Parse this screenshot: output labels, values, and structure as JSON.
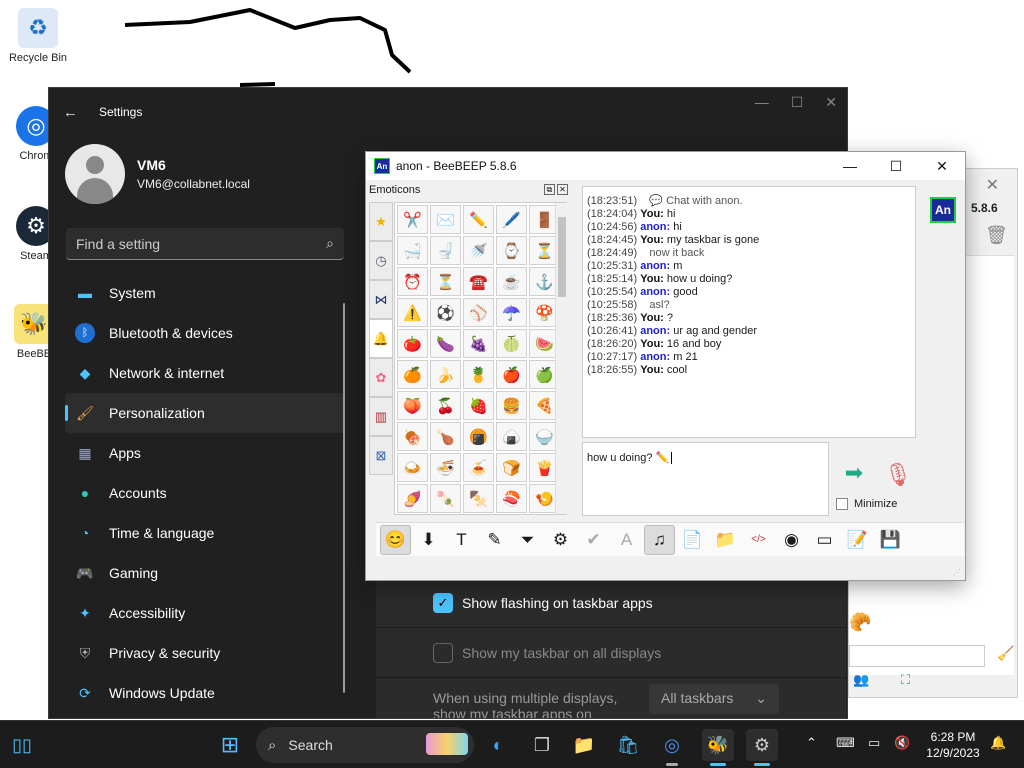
{
  "desktop": {
    "icons": [
      {
        "label": "Recycle Bin",
        "icon": "recycle-bin-icon"
      },
      {
        "label": "Chrom",
        "icon": "chrome-icon"
      },
      {
        "label": "Steam",
        "icon": "steam-icon"
      },
      {
        "label": "BeeBE",
        "icon": "beebeep-icon"
      }
    ]
  },
  "settings": {
    "title": "Settings",
    "user_name": "VM6",
    "user_email": "VM6@collabnet.local",
    "search_placeholder": "Find a setting",
    "nav": [
      {
        "label": "System",
        "icon": "monitor-icon"
      },
      {
        "label": "Bluetooth & devices",
        "icon": "bluetooth-icon"
      },
      {
        "label": "Network & internet",
        "icon": "wifi-icon"
      },
      {
        "label": "Personalization",
        "icon": "brush-icon",
        "active": true
      },
      {
        "label": "Apps",
        "icon": "apps-icon"
      },
      {
        "label": "Accounts",
        "icon": "person-icon"
      },
      {
        "label": "Time & language",
        "icon": "globe-clock-icon"
      },
      {
        "label": "Gaming",
        "icon": "gamepad-icon"
      },
      {
        "label": "Accessibility",
        "icon": "accessibility-icon"
      },
      {
        "label": "Privacy & security",
        "icon": "shield-icon"
      },
      {
        "label": "Windows Update",
        "icon": "update-icon"
      }
    ],
    "options": [
      {
        "label": "Show flashing on taskbar apps",
        "checked": true
      },
      {
        "label": "Show my taskbar on all displays",
        "checked": false
      }
    ],
    "multi_display_label": "When using multiple displays, show my taskbar apps on",
    "multi_display_value": "All taskbars"
  },
  "beebeep_back": {
    "version": "5.8.6"
  },
  "beebeep": {
    "title": "anon - BeeBEEP 5.8.6",
    "logo_text": "An",
    "emoticons_label": "Emoticons",
    "emoticon_categories": [
      "star-icon",
      "clock-icon",
      "bowtie-icon",
      "bell-icon",
      "flower-icon",
      "building-icon",
      "symbols-icon"
    ],
    "emoticons": [
      "✂️",
      "✉️",
      "✏️",
      "🖊️",
      "🚪",
      "🛁",
      "🚽",
      "🚿",
      "⌚",
      "⏳",
      "⏰",
      "⏳",
      "☎️",
      "☕",
      "⚓",
      "⚠️",
      "⚽",
      "⚾",
      "☂️",
      "🍄",
      "🍅",
      "🍆",
      "🍇",
      "🍈",
      "🍉",
      "🍊",
      "🍌",
      "🍍",
      "🍎",
      "🍏",
      "🍑",
      "🍒",
      "🍓",
      "🍔",
      "🍕",
      "🍖",
      "🍗",
      "🍘",
      "🍙",
      "🍚",
      "🍛",
      "🍜",
      "🍝",
      "🍞",
      "🍟",
      "🍠",
      "🍡",
      "🍢",
      "🍣",
      "🍤",
      "🍥",
      "🍦",
      "🍧",
      "🍨",
      "🍩"
    ],
    "chat": [
      {
        "ts": "(18:23:51)",
        "who": "",
        "text": "💬 Chat with anon."
      },
      {
        "ts": "(18:24:04)",
        "who": "You:",
        "text": "hi"
      },
      {
        "ts": "(10:24:56)",
        "who": "anon:",
        "text": "hi"
      },
      {
        "ts": "(18:24:45)",
        "who": "You:",
        "text": "my taskbar is gone"
      },
      {
        "ts": "(18:24:49)",
        "who": "",
        "text": "now it back"
      },
      {
        "ts": "(10:25:31)",
        "who": "anon:",
        "text": "m"
      },
      {
        "ts": "(18:25:14)",
        "who": "You:",
        "text": "how u doing?"
      },
      {
        "ts": "(10:25:54)",
        "who": "anon:",
        "text": "good"
      },
      {
        "ts": "(10:25:58)",
        "who": "",
        "text": "asl?"
      },
      {
        "ts": "(18:25:36)",
        "who": "You:",
        "text": "?"
      },
      {
        "ts": "(10:26:41)",
        "who": "anon:",
        "text": "ur ag and gender"
      },
      {
        "ts": "(18:26:20)",
        "who": "You:",
        "text": "16 and boy"
      },
      {
        "ts": "(10:27:17)",
        "who": "anon:",
        "text": "m 21"
      },
      {
        "ts": "(18:26:55)",
        "who": "You:",
        "text": "cool"
      }
    ],
    "input_text": "how u doing? ✏️",
    "minimize_label": "Minimize",
    "toolbar": [
      {
        "icon": "smiley-icon",
        "glyph": "😊",
        "selected": true
      },
      {
        "icon": "arrow-down-icon",
        "glyph": "⬇"
      },
      {
        "icon": "font-icon",
        "glyph": "T"
      },
      {
        "icon": "color-icon",
        "glyph": "✎"
      },
      {
        "icon": "filter-icon",
        "glyph": "⏷"
      },
      {
        "icon": "settings-icon",
        "glyph": "⚙"
      },
      {
        "icon": "spellcheck-icon",
        "glyph": "✔",
        "gray": true
      },
      {
        "icon": "autocomplete-icon",
        "glyph": "A",
        "gray": true
      },
      {
        "icon": "music-icon",
        "glyph": "♫",
        "selected": true
      },
      {
        "icon": "send-file-icon",
        "glyph": "📄"
      },
      {
        "icon": "send-folder-icon",
        "glyph": "📁"
      },
      {
        "icon": "code-icon",
        "glyph": "</>"
      },
      {
        "icon": "screenshot-icon",
        "glyph": "◉"
      },
      {
        "icon": "terminal-icon",
        "glyph": "▭"
      },
      {
        "icon": "notes-icon",
        "glyph": "📝"
      },
      {
        "icon": "save-icon",
        "glyph": "💾"
      }
    ]
  },
  "taskbar": {
    "search_label": "Search",
    "time": "6:28 PM",
    "date": "12/9/2023"
  }
}
